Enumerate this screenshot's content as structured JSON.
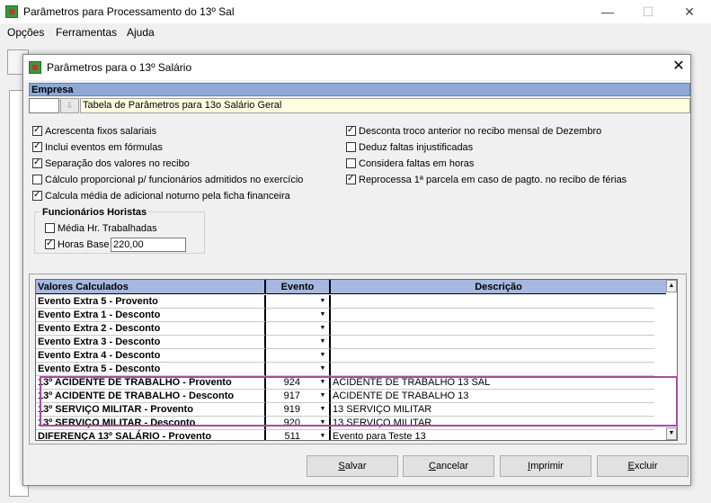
{
  "window": {
    "title": "Parâmetros para Processamento do 13º Sal",
    "controls": {
      "minimize": "—",
      "maximize": "☐",
      "close": "✕"
    }
  },
  "menu": [
    "Opções",
    "Ferramentas",
    "Ajuda"
  ],
  "dialog": {
    "title": "Parâmetros para o 13º Salário",
    "close": "✕",
    "empresa": {
      "header": "Empresa",
      "code": "",
      "lookup_icon": "⇩",
      "name": "Tabela de Parâmetros para 13o Salário Geral"
    },
    "options_left": [
      {
        "label": "Acrescenta fixos salariais",
        "checked": true
      },
      {
        "label": "Inclui eventos em fórmulas",
        "checked": true
      },
      {
        "label": "Separação dos valores no recibo",
        "checked": true
      },
      {
        "label": "Cálculo proporcional p/ funcionários admitidos no exercício",
        "checked": false
      },
      {
        "label": "Calcula média de adicional noturno pela ficha financeira",
        "checked": true
      }
    ],
    "options_right": [
      {
        "label": "Desconta troco anterior no recibo mensal de Dezembro",
        "checked": true
      },
      {
        "label": "Deduz faltas injustificadas",
        "checked": false
      },
      {
        "label": "Considera faltas em horas",
        "checked": false
      },
      {
        "label": "Reprocessa 1ª parcela em caso de pagto. no recibo de férias",
        "checked": true
      }
    ],
    "horistas": {
      "title": "Funcionários Horistas",
      "media_label": "Média Hr. Trabalhadas",
      "media_checked": false,
      "horas_label": "Horas Base",
      "horas_checked": true,
      "horas_value": "220,00"
    },
    "grid": {
      "headers": [
        "Valores Calculados",
        "Evento",
        "Descrição"
      ],
      "rows": [
        {
          "valor": "Evento Extra 5 - Provento",
          "evento": "",
          "descricao": ""
        },
        {
          "valor": "Evento Extra 1 - Desconto",
          "evento": "",
          "descricao": ""
        },
        {
          "valor": "Evento Extra 2 - Desconto",
          "evento": "",
          "descricao": ""
        },
        {
          "valor": "Evento Extra 3 - Desconto",
          "evento": "",
          "descricao": ""
        },
        {
          "valor": "Evento Extra 4 - Desconto",
          "evento": "",
          "descricao": ""
        },
        {
          "valor": "Evento Extra 5 - Desconto",
          "evento": "",
          "descricao": ""
        },
        {
          "valor": "13º ACIDENTE DE TRABALHO - Provento",
          "evento": "924",
          "descricao": "ACIDENTE DE TRABALHO 13 SAL"
        },
        {
          "valor": "13º ACIDENTE DE TRABALHO - Desconto",
          "evento": "917",
          "descricao": "ACIDENTE DE TRABALHO 13"
        },
        {
          "valor": "13º SERVIÇO MILITAR - Provento",
          "evento": "919",
          "descricao": "13 SERVIÇO MILITAR"
        },
        {
          "valor": "13º SERVIÇO MILITAR - Desconto",
          "evento": "920",
          "descricao": "13 SERVIÇO MILITAR"
        },
        {
          "valor": "DIFERENÇA 13º SALÁRIO - Provento",
          "evento": "511",
          "descricao": "Evento para Teste 13"
        }
      ]
    },
    "buttons": {
      "salvar": "Salvar",
      "cancelar": "Cancelar",
      "imprimir": "Imprimir",
      "excluir": "Excluir"
    },
    "highlight_color": "#a84ca0",
    "header_color": "#a6b8e0"
  }
}
